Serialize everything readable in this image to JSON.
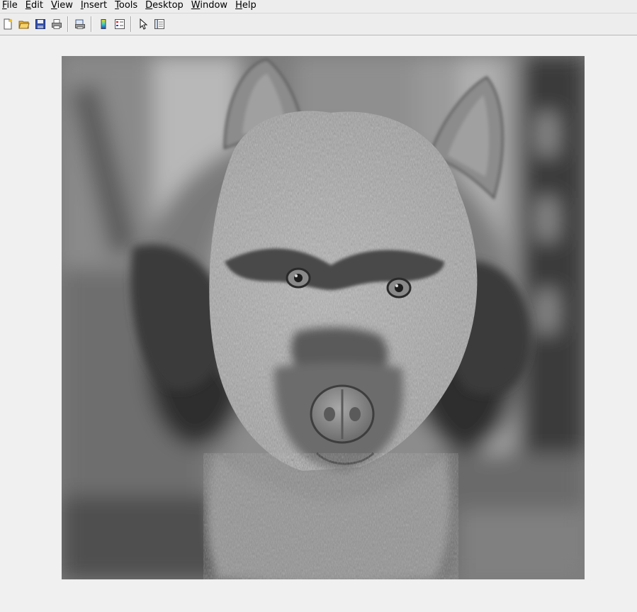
{
  "menubar": {
    "items": [
      {
        "label": "File",
        "mnemonic": "F"
      },
      {
        "label": "Edit",
        "mnemonic": "E"
      },
      {
        "label": "View",
        "mnemonic": "V"
      },
      {
        "label": "Insert",
        "mnemonic": "I"
      },
      {
        "label": "Tools",
        "mnemonic": "T"
      },
      {
        "label": "Desktop",
        "mnemonic": "D"
      },
      {
        "label": "Window",
        "mnemonic": "W"
      },
      {
        "label": "Help",
        "mnemonic": "H"
      }
    ]
  },
  "toolbar": {
    "buttons": [
      {
        "icon": "new-figure-icon"
      },
      {
        "icon": "open-file-icon"
      },
      {
        "icon": "save-icon"
      },
      {
        "icon": "print-icon"
      },
      {
        "icon": "print-preview-icon"
      },
      {
        "icon": "colorbar-icon"
      },
      {
        "icon": "legend-icon"
      },
      {
        "icon": "edit-plot-arrow-icon"
      },
      {
        "icon": "property-editor-icon"
      }
    ]
  },
  "image": {
    "description_icon": "hybrid-image-icon",
    "colormap": "grayscale"
  }
}
